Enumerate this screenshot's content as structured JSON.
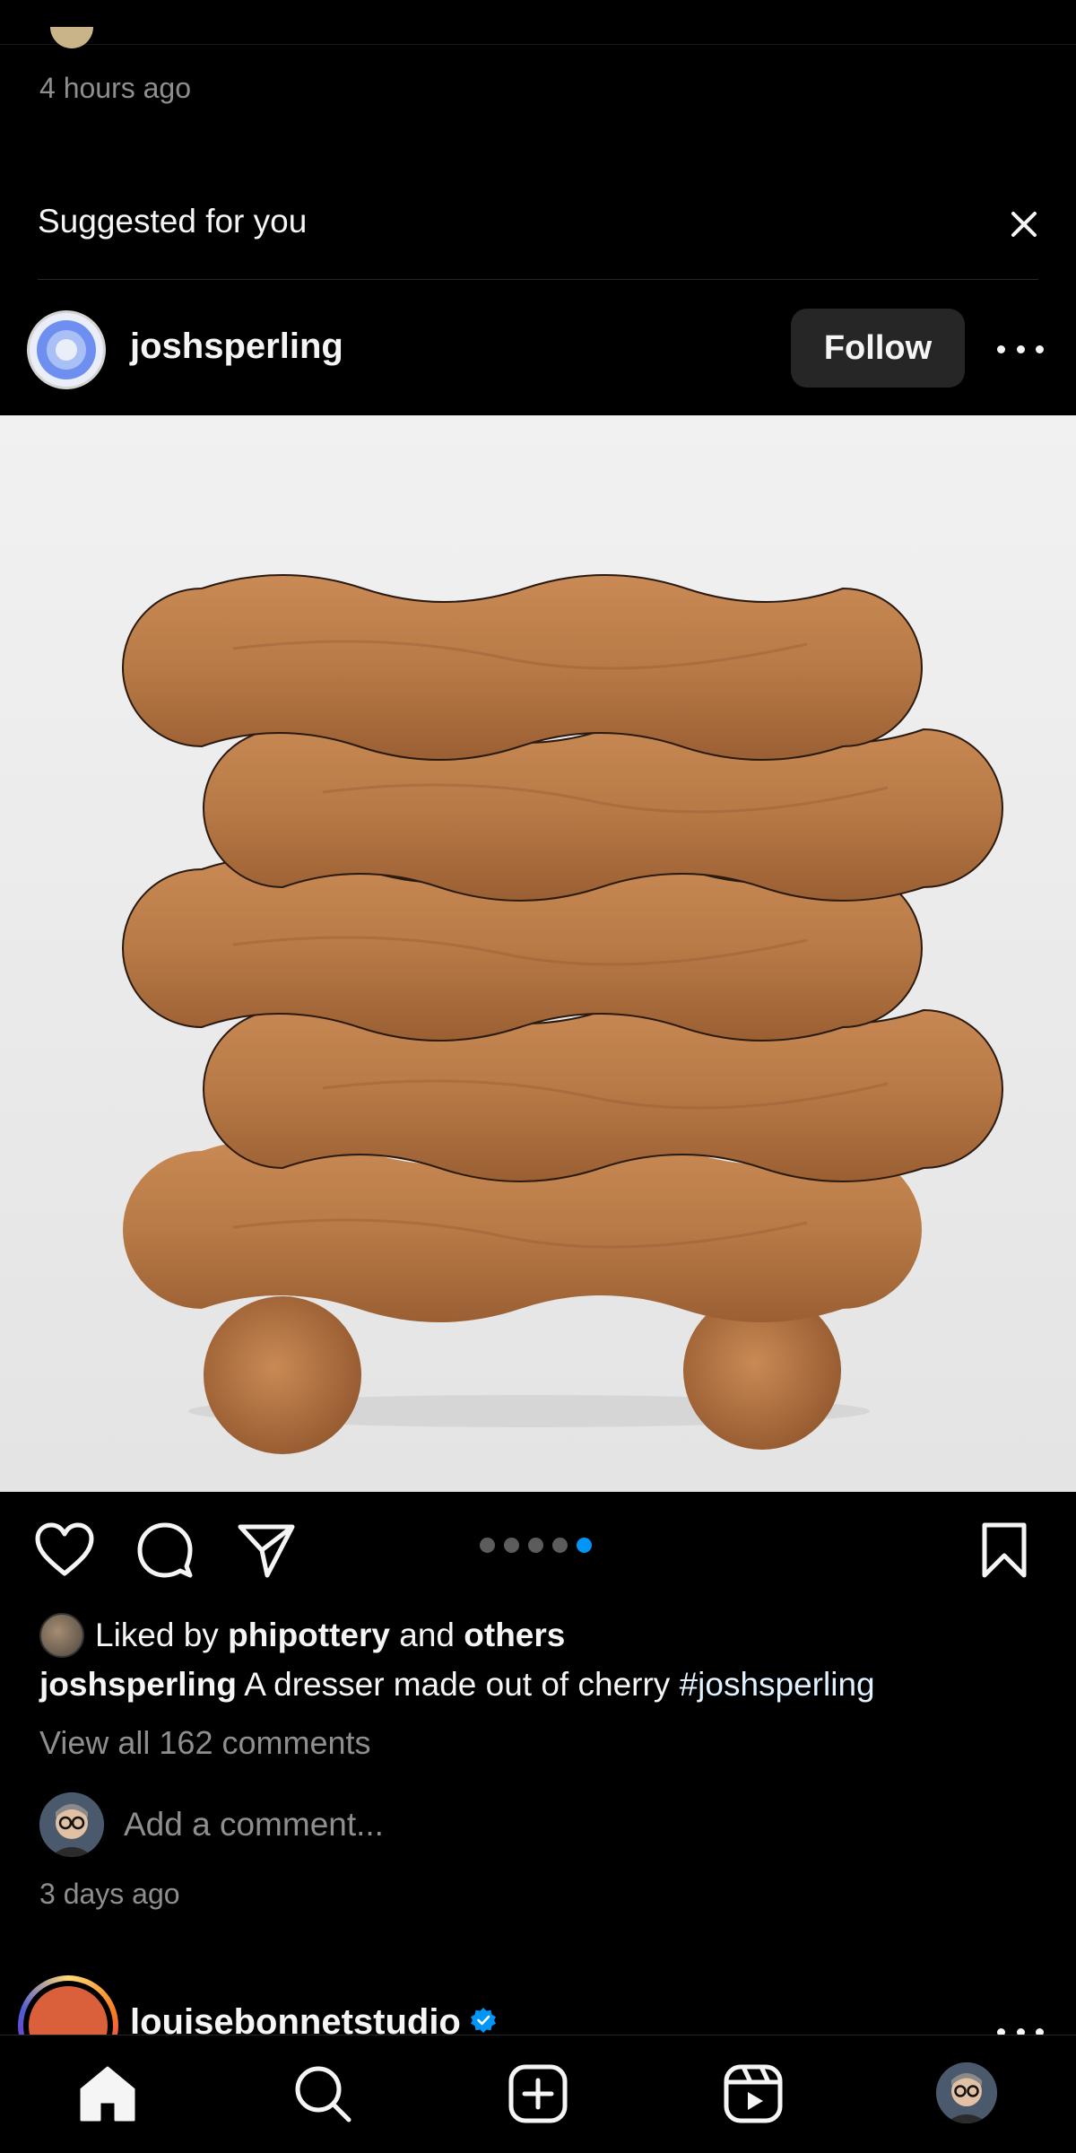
{
  "previous_post": {
    "time": "4 hours ago"
  },
  "suggested": {
    "title": "Suggested for you"
  },
  "post": {
    "username": "joshsperling",
    "follow_label": "Follow",
    "carousel": {
      "total": 5,
      "active_index": 4
    },
    "liked_by": {
      "prefix": "Liked by",
      "user": "phipottery",
      "connector": "and",
      "others": "others"
    },
    "caption": {
      "username": "joshsperling",
      "text": "A dresser made out of cherry",
      "hashtag": "#joshsperling"
    },
    "view_comments": "View all 162 comments",
    "add_comment_placeholder": "Add a comment...",
    "time": "3 days ago"
  },
  "next_post": {
    "username": "louisebonnetstudio",
    "verified": true
  },
  "colors": {
    "background": "#000000",
    "text_primary": "#f5f5f5",
    "text_secondary": "#8e8e8e",
    "accent": "#0095f6",
    "button_bg": "#262626"
  },
  "icons": {
    "actions": [
      "heart-icon",
      "comment-icon",
      "share-icon",
      "bookmark-icon"
    ],
    "tabs": [
      "home-icon",
      "search-icon",
      "create-icon",
      "reels-icon",
      "profile-avatar"
    ]
  }
}
